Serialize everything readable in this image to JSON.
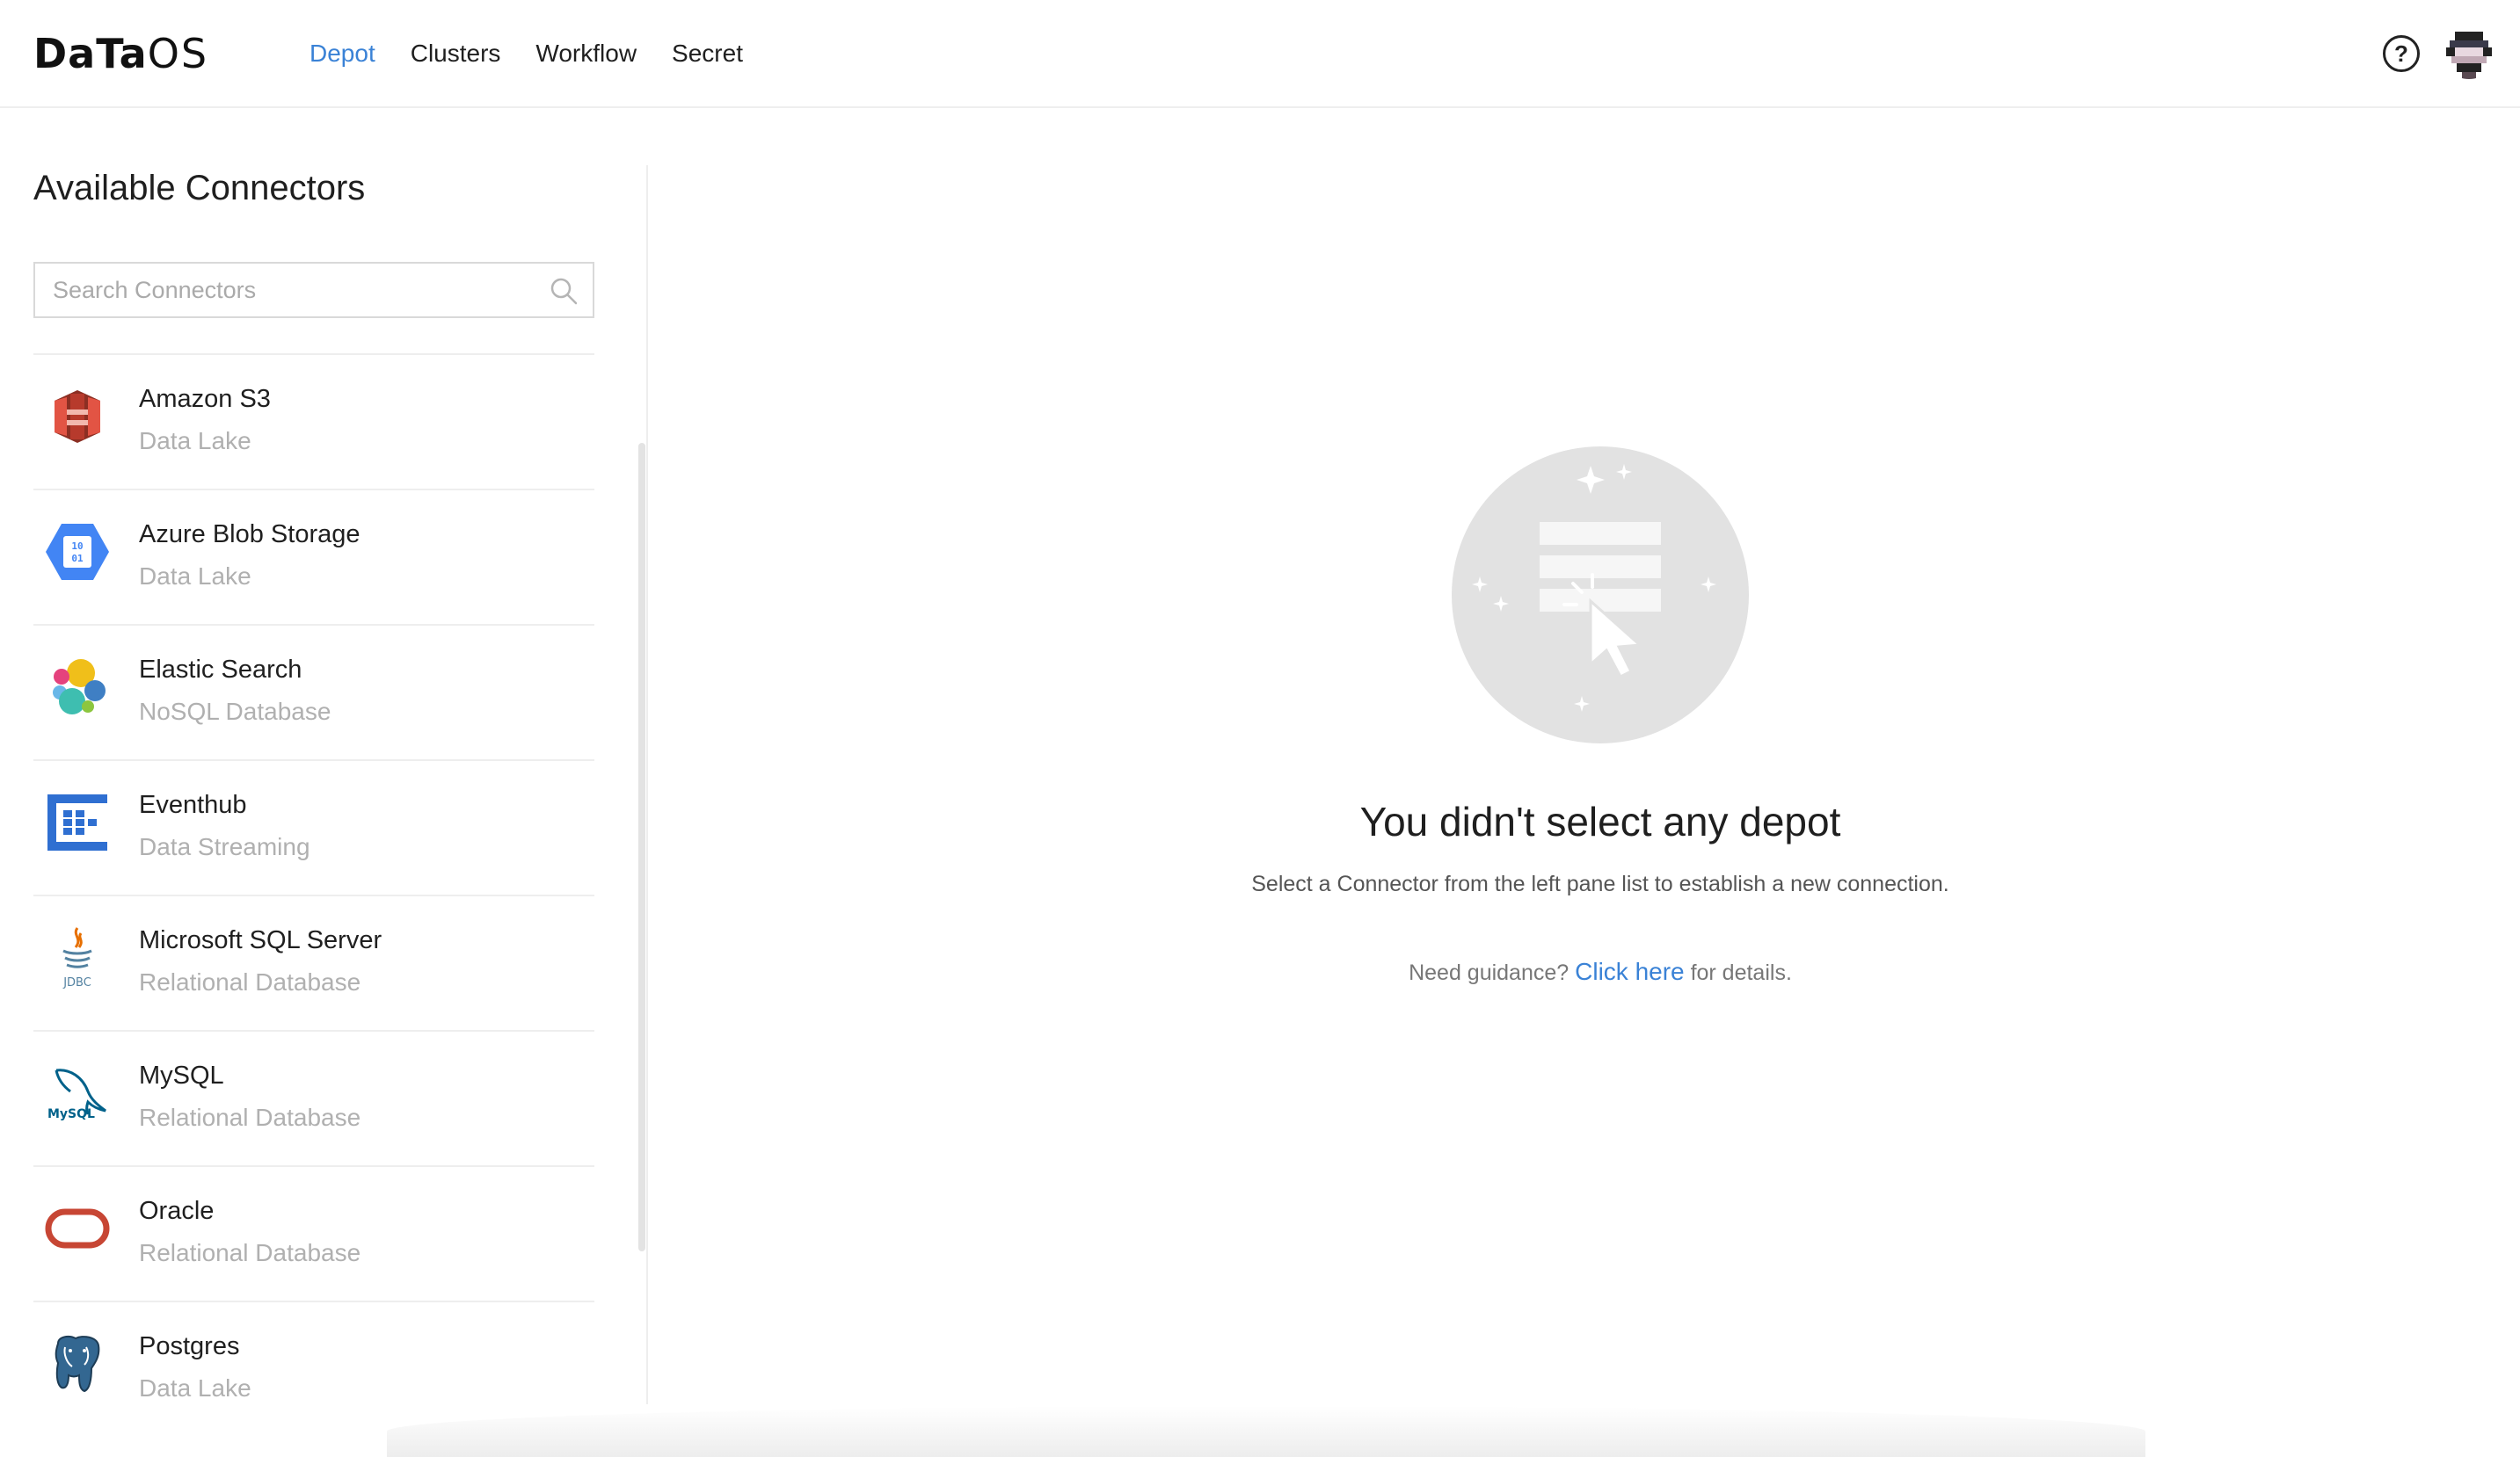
{
  "brand": {
    "logo_bold": "DaTa",
    "logo_light": "OS"
  },
  "nav": {
    "items": [
      {
        "label": "Depot",
        "active": true
      },
      {
        "label": "Clusters",
        "active": false
      },
      {
        "label": "Workflow",
        "active": false
      },
      {
        "label": "Secret",
        "active": false
      }
    ]
  },
  "header": {
    "help_icon": "question-circle-icon",
    "avatar_icon": "user-avatar"
  },
  "sidebar": {
    "title": "Available Connectors",
    "search_placeholder": "Search Connectors",
    "search_value": "",
    "connectors": [
      {
        "name": "Amazon S3",
        "type": "Data Lake",
        "icon": "amazon-s3-icon"
      },
      {
        "name": "Azure Blob Storage",
        "type": "Data Lake",
        "icon": "azure-blob-icon"
      },
      {
        "name": "Elastic Search",
        "type": "NoSQL Database",
        "icon": "elastic-search-icon"
      },
      {
        "name": "Eventhub",
        "type": "Data Streaming",
        "icon": "eventhub-icon"
      },
      {
        "name": "Microsoft SQL Server",
        "type": "Relational Database",
        "icon": "jdbc-java-icon",
        "icon_text": "JDBC"
      },
      {
        "name": "MySQL",
        "type": "Relational Database",
        "icon": "mysql-dolphin-icon",
        "icon_text": "MySQL"
      },
      {
        "name": "Oracle",
        "type": "Relational Database",
        "icon": "oracle-icon"
      },
      {
        "name": "Postgres",
        "type": "Data Lake",
        "icon": "postgres-elephant-icon"
      }
    ]
  },
  "empty_state": {
    "title": "You didn't select any depot",
    "subtitle": "Select a Connector from the left pane list to establish a new connection.",
    "guide_prefix": "Need guidance?",
    "guide_link": "Click here",
    "guide_suffix": "for details."
  },
  "colors": {
    "accent": "#3a82d6",
    "muted_text": "#b0b0b0",
    "divider": "#eeeeee",
    "empty_circle": "#e2e2e2"
  }
}
